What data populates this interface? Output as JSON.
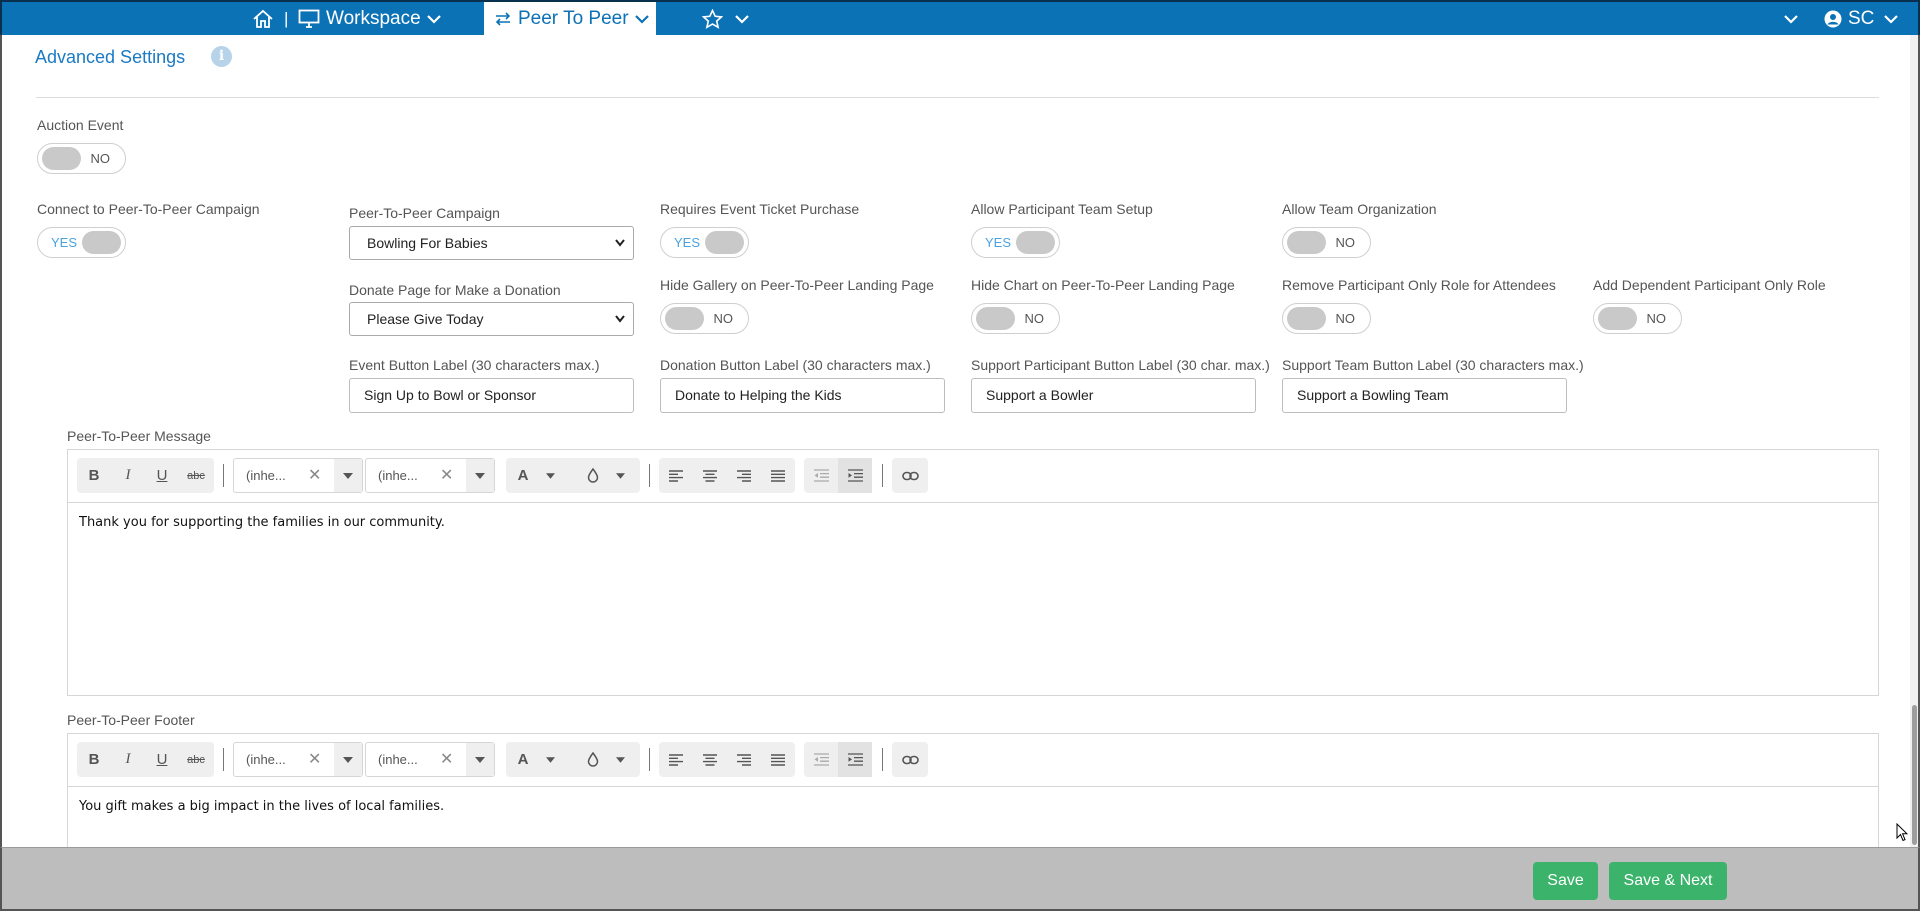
{
  "nav": {
    "workspace_label": "Workspace",
    "peer_label": "Peer To Peer",
    "separator": "|",
    "user_initials": "SC"
  },
  "section": {
    "title": "Advanced Settings",
    "info_glyph": "i"
  },
  "auction": {
    "label": "Auction Event",
    "toggle": "NO"
  },
  "connect": {
    "label": "Connect to Peer-To-Peer Campaign",
    "toggle": "YES"
  },
  "campaign": {
    "label": "Peer-To-Peer Campaign",
    "value": "Bowling For Babies"
  },
  "ticket": {
    "label": "Requires Event Ticket Purchase",
    "toggle": "YES"
  },
  "team_setup": {
    "label": "Allow Participant Team Setup",
    "toggle": "YES"
  },
  "team_org": {
    "label": "Allow Team Organization",
    "toggle": "NO"
  },
  "donate_page": {
    "label": "Donate Page for Make a Donation",
    "value": "Please Give Today"
  },
  "hide_gallery": {
    "label": "Hide Gallery on Peer-To-Peer Landing Page",
    "toggle": "NO"
  },
  "hide_chart": {
    "label": "Hide Chart on Peer-To-Peer Landing Page",
    "toggle": "NO"
  },
  "remove_role": {
    "label": "Remove Participant Only Role for Attendees",
    "toggle": "NO"
  },
  "dependent_role": {
    "label": "Add Dependent Participant Only Role",
    "toggle": "NO"
  },
  "event_btn": {
    "label": "Event Button Label (30 characters max.)",
    "value": "Sign Up to Bowl or Sponsor"
  },
  "donation_btn": {
    "label": "Donation Button Label (30 characters max.)",
    "value": "Donate to Helping the Kids"
  },
  "support_participant": {
    "label": "Support Participant Button Label (30 char. max.)",
    "value": "Support a Bowler"
  },
  "support_team": {
    "label": "Support Team Button Label (30 characters max.)",
    "value": "Support a Bowling Team"
  },
  "toolbar": {
    "bold": "B",
    "italic": "I",
    "underline": "U",
    "strike": "abc",
    "font_family": "(inhe...",
    "font_size": "(inhe...",
    "clear": "✕",
    "font_color": "A"
  },
  "message": {
    "label": "Peer-To-Peer Message",
    "body": "Thank you for supporting the families in our community."
  },
  "footer_editor": {
    "label": "Peer-To-Peer Footer",
    "body": "You gift makes a big impact in the lives of local families."
  },
  "buttons": {
    "save": "Save",
    "save_next": "Save & Next"
  },
  "colors": {
    "nav_blue": "#0c72b6",
    "accent_blue": "#1a7ac4",
    "save_green": "#3bb36b"
  }
}
